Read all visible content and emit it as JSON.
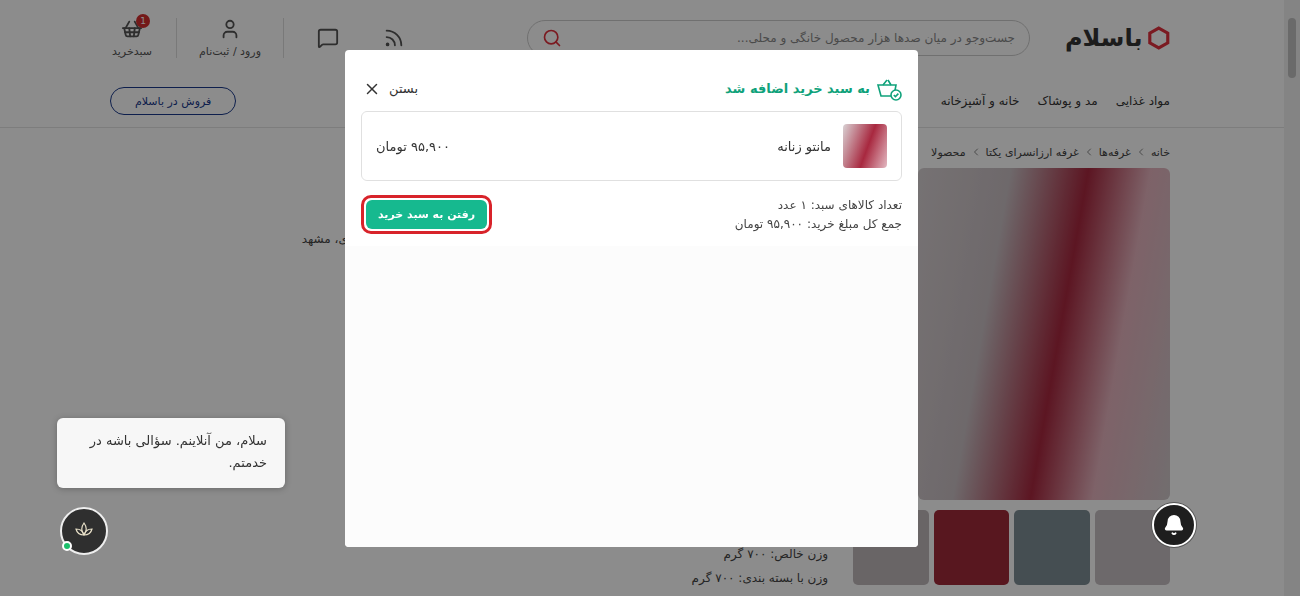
{
  "header": {
    "logo": "باسلام",
    "search": {
      "placeholder": "جست‌وجو در میان صدها هزار محصول خانگی و محلی..."
    },
    "login": {
      "label": "ورود / ثبت‌نام"
    },
    "cart": {
      "label": "سبدخرید",
      "badge": "1"
    }
  },
  "nav": {
    "categories": [
      "مواد غذایی",
      "مد و پوشاک",
      "خانه و آشپزخانه"
    ],
    "sell_button": "فروش در باسلام"
  },
  "breadcrumb": [
    "خانه",
    "غرفه‌ها",
    "غرفه ارزانسرای یکتا",
    "محصولا"
  ],
  "product": {
    "location": "رضوی، مشهد",
    "specs": [
      {
        "label": "وزن خالص:",
        "value": "۷۰۰ گرم"
      },
      {
        "label": "وزن با بسته بندی:",
        "value": "۷۰۰ گرم"
      }
    ]
  },
  "modal": {
    "title": "به سبد خرید اضافه شد",
    "close": "بستن",
    "item": {
      "name": "مانتو زنانه",
      "price": "۹۵,۹۰۰ تومان"
    },
    "summary": [
      {
        "label": "تعداد کالاهای سبد:",
        "value": "۱ عدد"
      },
      {
        "label": "جمع کل مبلغ خرید:",
        "value": "۹۵,۹۰۰ تومان"
      }
    ],
    "cta": {
      "label": "رفتن به سبد خرید",
      "highlighted": true
    }
  },
  "chat": {
    "message": "سلام، من آنلاینم. سؤالی باشه در خدمتم.",
    "online": true
  }
}
